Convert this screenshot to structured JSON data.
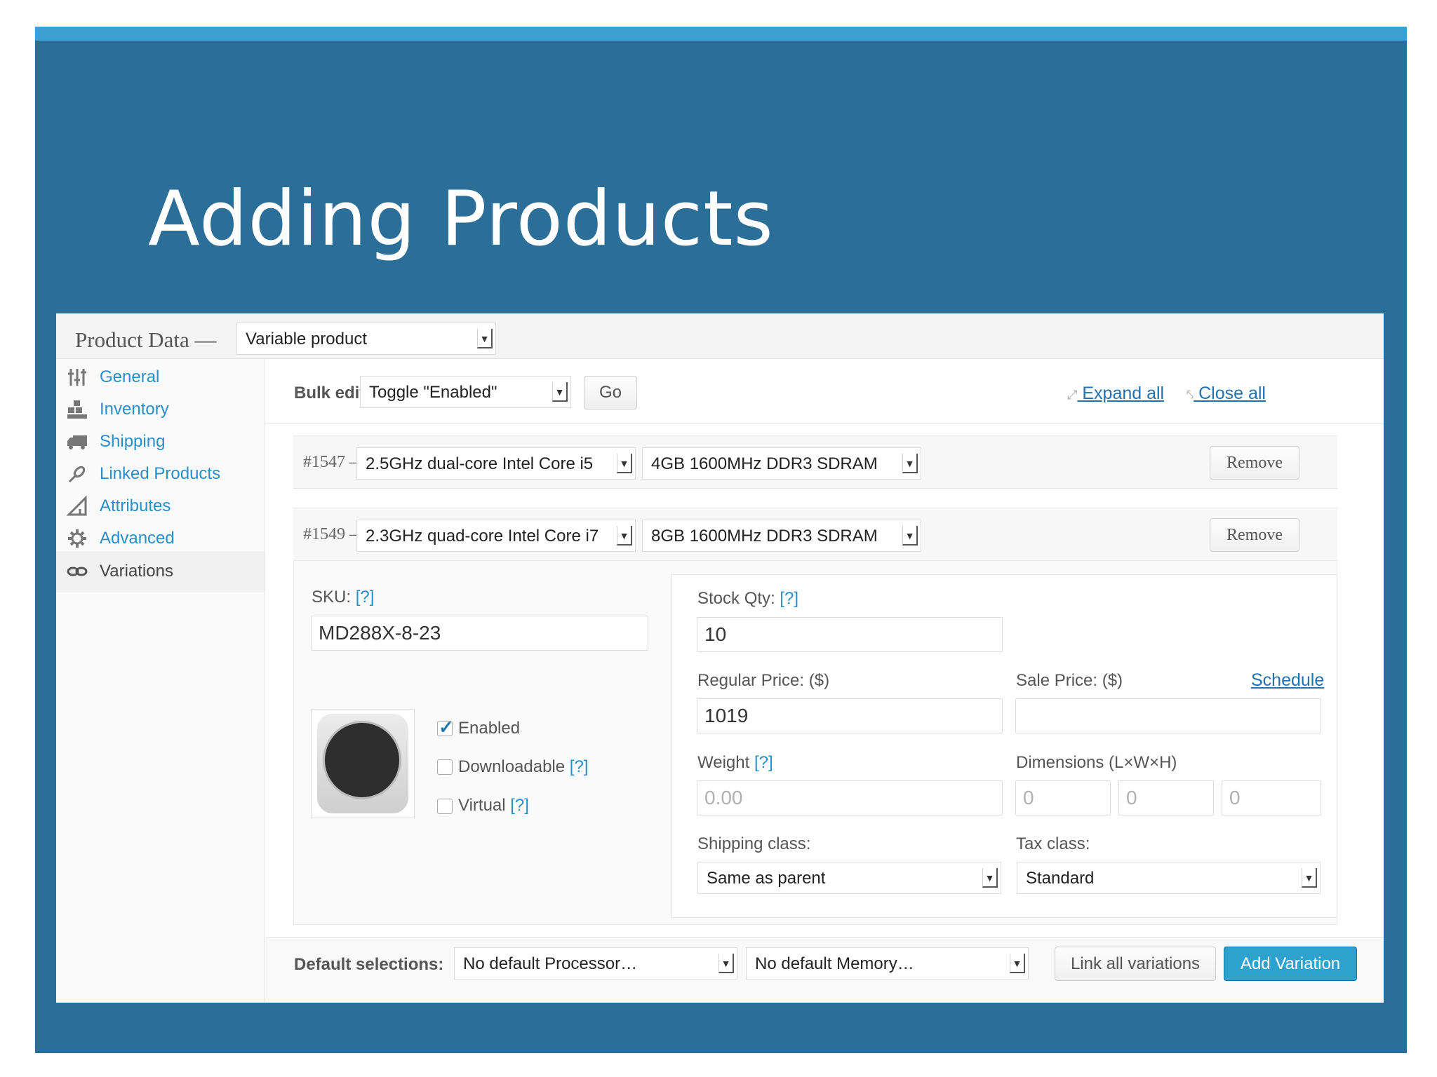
{
  "slide": {
    "title": "Adding Products"
  },
  "header": {
    "label": "Product Data —",
    "product_type": "Variable product"
  },
  "sidebar": {
    "tabs": [
      {
        "label": "General",
        "icon": "sliders-icon"
      },
      {
        "label": "Inventory",
        "icon": "boxes-icon"
      },
      {
        "label": "Shipping",
        "icon": "truck-icon"
      },
      {
        "label": "Linked Products",
        "icon": "link-icon"
      },
      {
        "label": "Attributes",
        "icon": "triangle-ruler-icon"
      },
      {
        "label": "Advanced",
        "icon": "gear-icon"
      },
      {
        "label": "Variations",
        "icon": "infinity-icon",
        "active": true
      }
    ]
  },
  "toolbar": {
    "bulk_label": "Bulk edit:",
    "bulk_action": "Toggle \"Enabled\"",
    "go": "Go",
    "expand_all": "Expand all",
    "close_all": "Close all"
  },
  "variations": [
    {
      "id": "#1547 —",
      "processor": "2.5GHz dual-core Intel Core i5",
      "memory": "4GB 1600MHz DDR3 SDRAM",
      "remove": "Remove"
    },
    {
      "id": "#1549 —",
      "processor": "2.3GHz quad-core Intel Core i7",
      "memory": "8GB 1600MHz DDR3 SDRAM",
      "remove": "Remove"
    }
  ],
  "detail": {
    "sku_label": "SKU:",
    "sku": "MD288X-8-23",
    "help": "[?]",
    "enabled_label": "Enabled",
    "enabled": true,
    "downloadable_label": "Downloadable",
    "downloadable": false,
    "virtual_label": "Virtual",
    "virtual": false,
    "stock_label": "Stock Qty:",
    "stock": "10",
    "regular_price_label": "Regular Price: ($)",
    "regular_price": "1019",
    "sale_price_label": "Sale Price: ($)",
    "sale_price": "",
    "schedule": "Schedule",
    "weight_label": "Weight",
    "weight_placeholder": "0.00",
    "dimensions_label": "Dimensions (L×W×H)",
    "dim_l": "0",
    "dim_w": "0",
    "dim_h": "0",
    "shipping_class_label": "Shipping class:",
    "shipping_class": "Same as parent",
    "tax_class_label": "Tax class:",
    "tax_class": "Standard"
  },
  "footer": {
    "default_label": "Default selections:",
    "default_processor": "No default Processor…",
    "default_memory": "No default Memory…",
    "link_all": "Link all variations",
    "add_variation": "Add Variation"
  },
  "colors": {
    "slide_bg": "#2b6f99",
    "slide_bar": "#3d9fd4",
    "link": "#2a8ec8",
    "primary_button": "#2ea2cc"
  }
}
